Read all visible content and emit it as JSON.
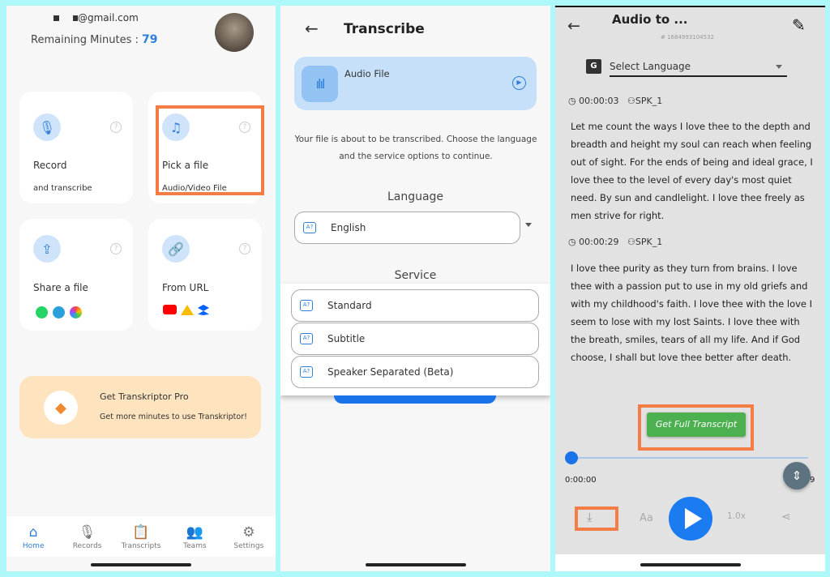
{
  "home": {
    "email": "@gmail.com",
    "remaining_label": "Remaining Minutes :",
    "remaining_value": "79",
    "cards": [
      {
        "title": "Record",
        "subtitle": "and transcribe",
        "icon": "microphone-icon"
      },
      {
        "title": "Pick a file",
        "subtitle": "Audio/Video File",
        "icon": "music-file-icon"
      },
      {
        "title": "Share a file",
        "subtitle": "",
        "icon": "upload-icon"
      },
      {
        "title": "From URL",
        "subtitle": "",
        "icon": "link-icon"
      }
    ],
    "pro": {
      "title": "Get Transkriptor Pro",
      "subtitle": "Get more minutes to use Transkriptor!"
    },
    "nav": [
      {
        "label": "Home",
        "active": true
      },
      {
        "label": "Records"
      },
      {
        "label": "Transcripts"
      },
      {
        "label": "Teams"
      },
      {
        "label": "Settings"
      }
    ],
    "accent": "#2f7fd8",
    "highlight": "#f47c45"
  },
  "transcribe": {
    "title": "Transcribe",
    "file_label": "Audio File",
    "message": "Your file is about to be transcribed. Choose the language and the service options to continue.",
    "language_heading": "Language",
    "language_value": "English",
    "service_heading": "Service",
    "services": [
      "Standard",
      "Subtitle",
      "Speaker Separated (Beta)"
    ]
  },
  "player": {
    "title": "Audio to ...",
    "id": "# 1684993104532",
    "language_placeholder": "Select Language",
    "segments": [
      {
        "time": "00:00:03",
        "speaker": "SPK_1",
        "text": "Let me count the ways I love thee to the depth and breadth and height my soul can reach when feeling out of sight. For the ends of being and ideal grace, I love thee to the level of every day's most quiet need. By sun and candlelight. I love thee freely as men strive for right."
      },
      {
        "time": "00:00:29",
        "speaker": "SPK_1",
        "text": "I love thee purity as they turn from brains. I love thee with a passion put to use in my old griefs and with my childhood's faith. I love thee with the love I seem to lose with my lost Saints. I love thee with the breath, smiles, tears of all my life. And if God choose, I shall but love thee better after death."
      }
    ],
    "cta": "Get Full Transcript",
    "position": "0:00:00",
    "duration_partial": "9",
    "progress": 0,
    "font_label": "Aa",
    "speed": "1.0x",
    "cta_color": "#4caf50"
  }
}
